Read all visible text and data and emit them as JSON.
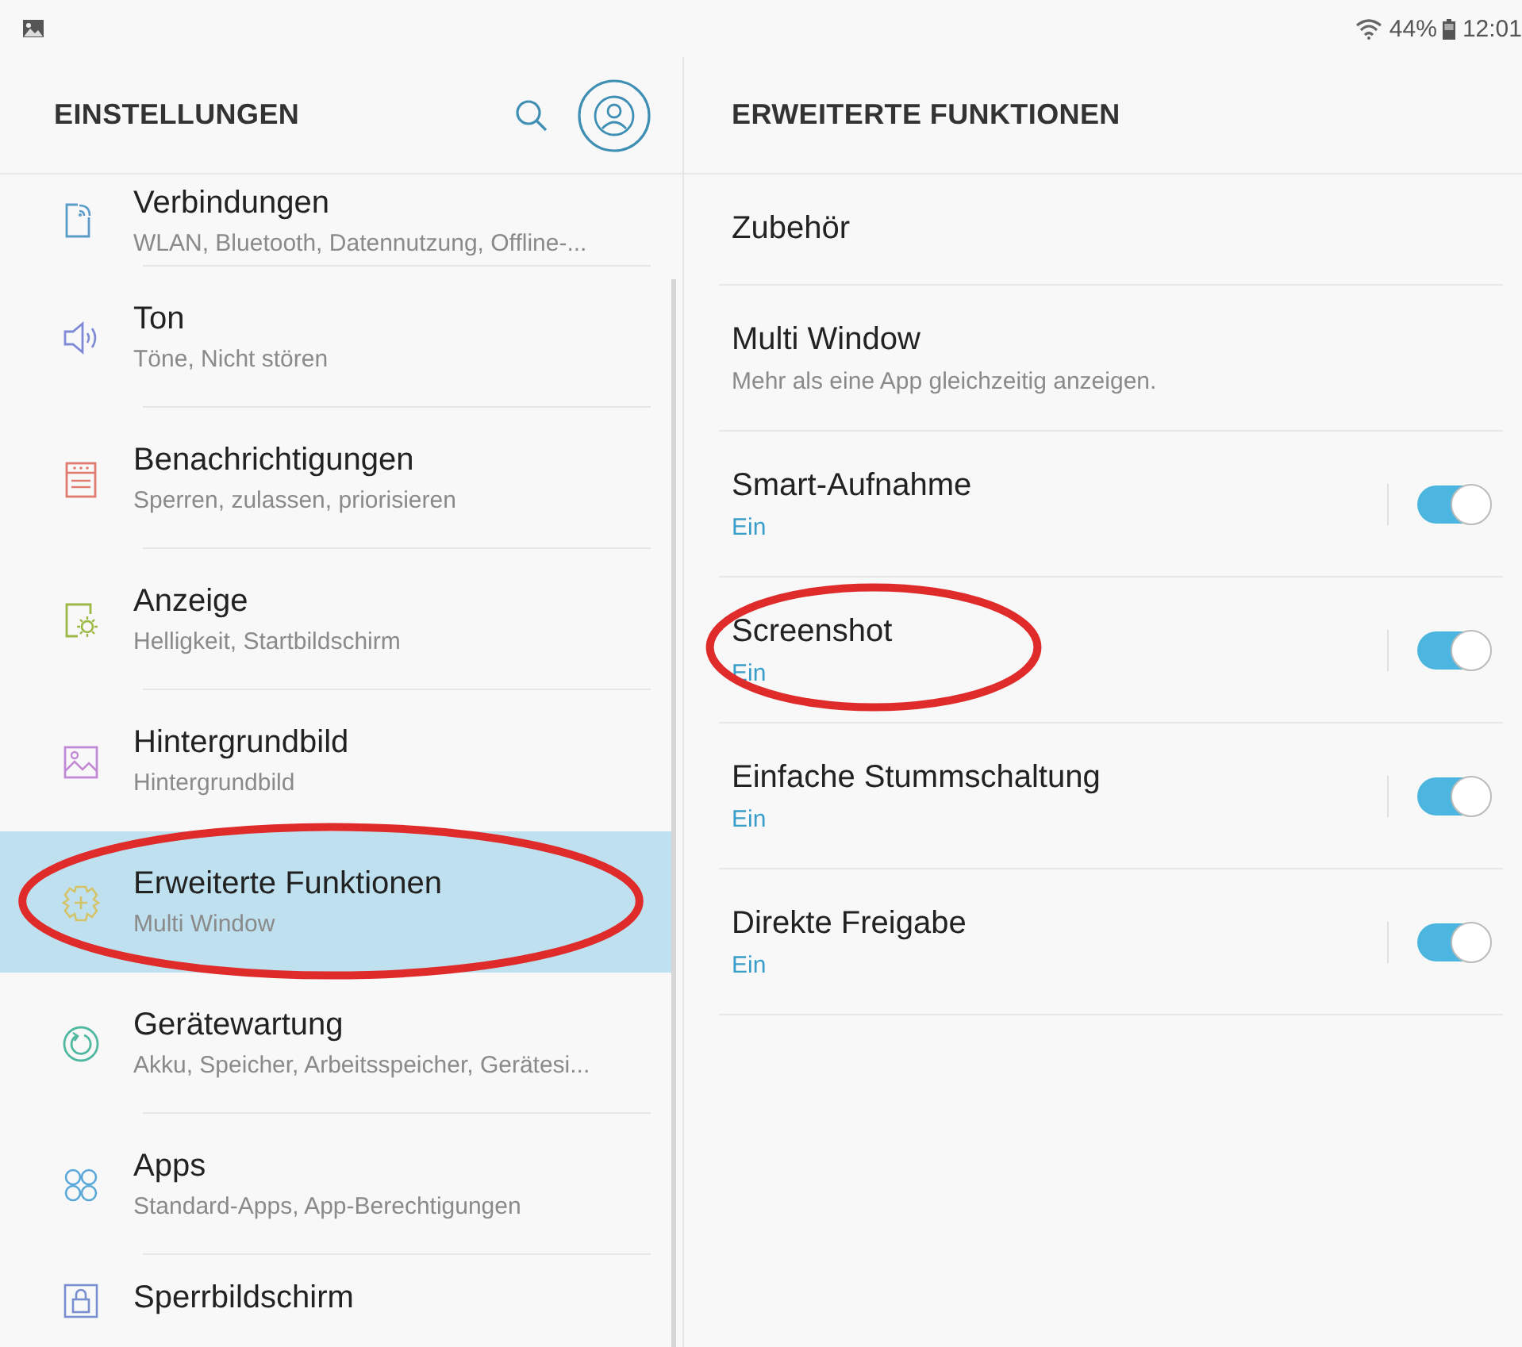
{
  "status_bar": {
    "battery": "44%",
    "time": "12:01"
  },
  "left_panel": {
    "title": "EINSTELLUNGEN",
    "items": [
      {
        "kind": "connections",
        "title": "Verbindungen",
        "subtitle": "WLAN, Bluetooth, Datennutzung, Offline-...",
        "selected": false,
        "circled": false
      },
      {
        "kind": "sound",
        "title": "Ton",
        "subtitle": "Töne, Nicht stören",
        "selected": false,
        "circled": false
      },
      {
        "kind": "notifications",
        "title": "Benachrichtigungen",
        "subtitle": "Sperren, zulassen, priorisieren",
        "selected": false,
        "circled": false
      },
      {
        "kind": "display",
        "title": "Anzeige",
        "subtitle": "Helligkeit, Startbildschirm",
        "selected": false,
        "circled": false
      },
      {
        "kind": "wallpaper",
        "title": "Hintergrundbild",
        "subtitle": "Hintergrundbild",
        "selected": false,
        "circled": false
      },
      {
        "kind": "advanced",
        "title": "Erweiterte Funktionen",
        "subtitle": "Multi Window",
        "selected": true,
        "circled": true
      },
      {
        "kind": "maintenance",
        "title": "Gerätewartung",
        "subtitle": "Akku, Speicher, Arbeitsspeicher, Gerätesi...",
        "selected": false,
        "circled": false
      },
      {
        "kind": "apps",
        "title": "Apps",
        "subtitle": "Standard-Apps, App-Berechtigungen",
        "selected": false,
        "circled": false
      },
      {
        "kind": "lock",
        "title": "Sperrbildschirm",
        "selected": false,
        "circled": false
      }
    ]
  },
  "right_panel": {
    "title": "ERWEITERTE FUNKTIONEN",
    "items": [
      {
        "kind": "plain",
        "title": "Zubehör",
        "circled": false
      },
      {
        "kind": "info",
        "title": "Multi Window",
        "subtitle": "Mehr als eine App gleichzeitig anzeigen.",
        "circled": false
      },
      {
        "kind": "toggle",
        "title": "Smart-Aufnahme",
        "subtitle": "Ein",
        "on": true,
        "circled": false
      },
      {
        "kind": "toggle",
        "title": "Screenshot",
        "subtitle": "Ein",
        "on": true,
        "circled": true
      },
      {
        "kind": "toggle",
        "title": "Einfache Stummschaltung",
        "subtitle": "Ein",
        "on": true,
        "circled": false
      },
      {
        "kind": "toggle",
        "title": "Direkte Freigabe",
        "subtitle": "Ein",
        "on": true,
        "circled": false
      }
    ]
  }
}
